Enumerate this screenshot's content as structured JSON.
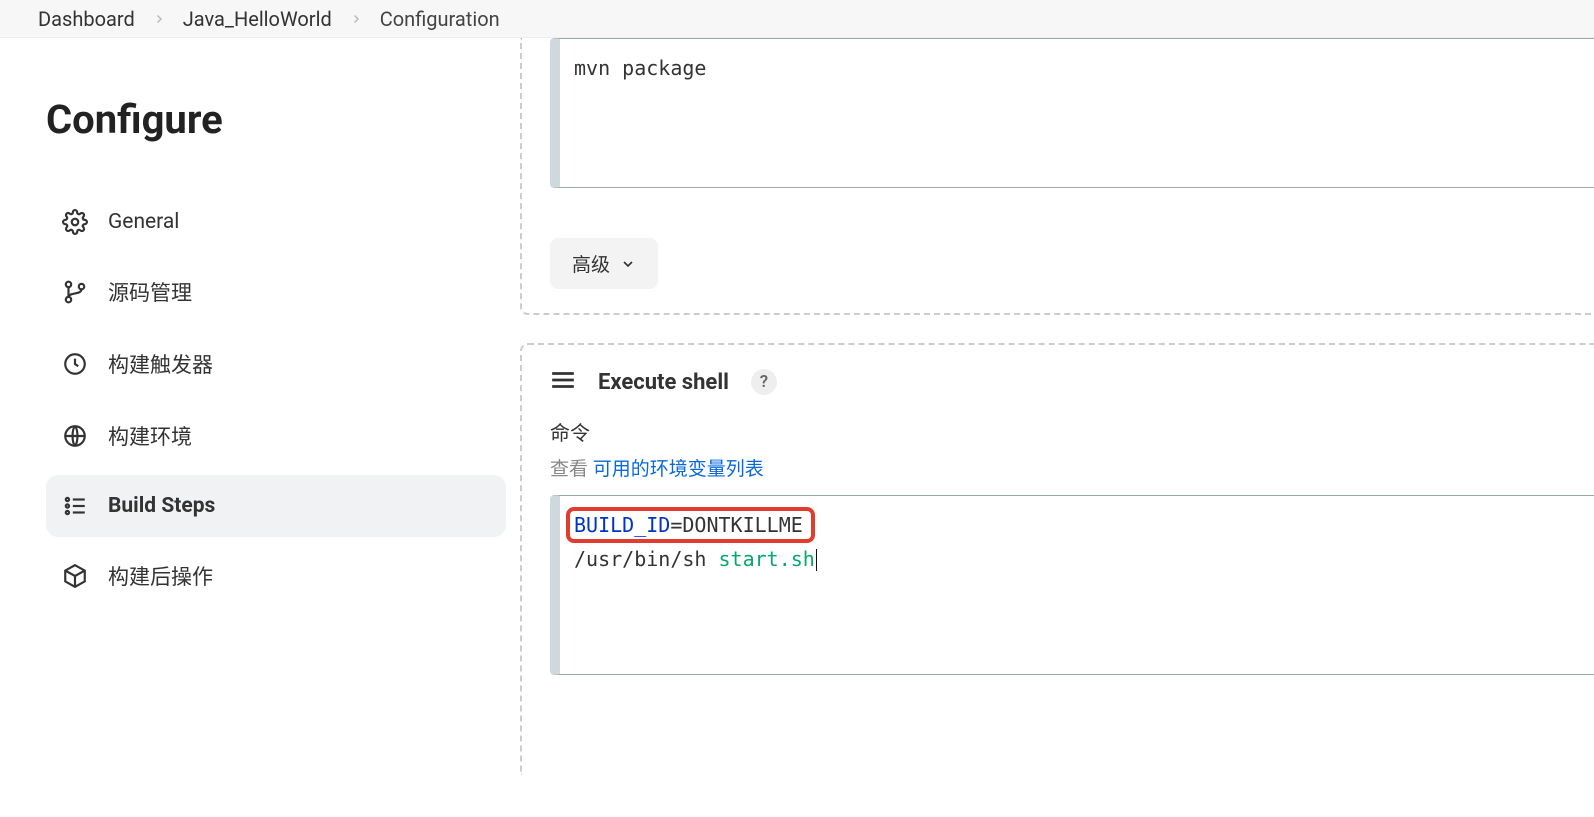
{
  "breadcrumb": [
    "Dashboard",
    "Java_HelloWorld",
    "Configuration"
  ],
  "sidebar": {
    "title": "Configure",
    "items": [
      {
        "label": "General",
        "icon": "gear"
      },
      {
        "label": "源码管理",
        "icon": "branch"
      },
      {
        "label": "构建触发器",
        "icon": "clock"
      },
      {
        "label": "构建环境",
        "icon": "globe"
      },
      {
        "label": "Build Steps",
        "icon": "steps",
        "active": true
      },
      {
        "label": "构建后操作",
        "icon": "package"
      }
    ]
  },
  "block1": {
    "code": "mvn package",
    "advanced_label": "高级"
  },
  "block2": {
    "title": "Execute shell",
    "help": "?",
    "cmd_label": "命令",
    "hint_prefix": "查看 ",
    "hint_link": "可用的环境变量列表",
    "code": {
      "line1_key": "BUILD_ID",
      "line1_eq": "=",
      "line1_val": "DONTKILLME",
      "line2_a": "/usr/bin/sh ",
      "line2_b": "start.sh"
    }
  }
}
